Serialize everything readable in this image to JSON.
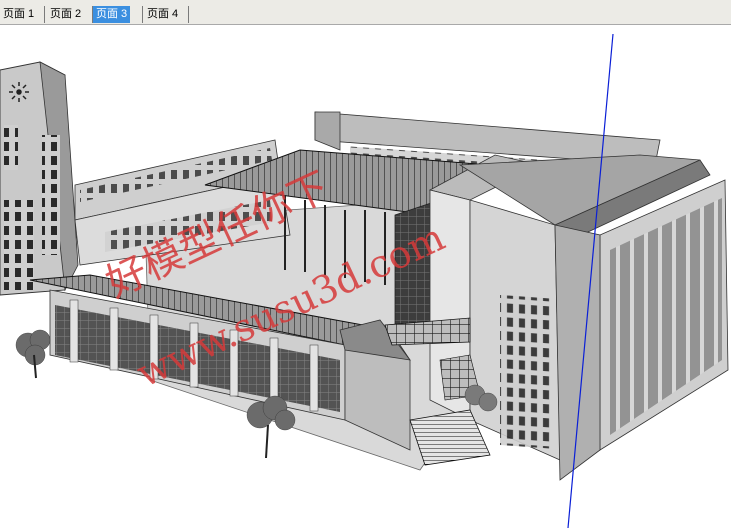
{
  "tabs": [
    {
      "label": "页面 1",
      "active": false
    },
    {
      "label": "页面 2",
      "active": false
    },
    {
      "label": "页面 3",
      "active": true
    },
    {
      "label": "页面 4",
      "active": false
    }
  ],
  "watermark": {
    "line1": "好模型任你下",
    "line2": "www.susu3d.com"
  },
  "colors": {
    "active_tab": "#3b8fe0",
    "axis_blue": "#0a1fd6",
    "watermark": "#d63a3a"
  }
}
